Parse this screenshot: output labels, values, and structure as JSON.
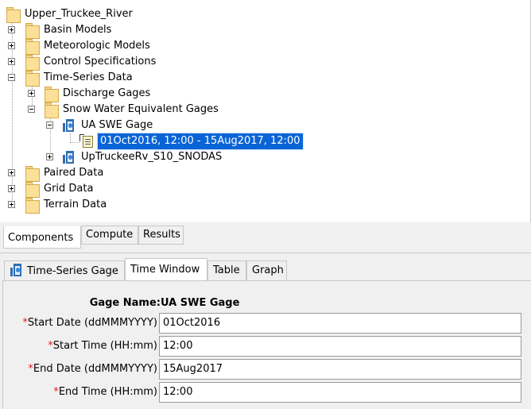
{
  "tree": {
    "root": "Upper_Truckee_River",
    "items": [
      {
        "label": "Basin Models"
      },
      {
        "label": "Meteorologic Models"
      },
      {
        "label": "Control Specifications"
      },
      {
        "label": "Time-Series Data"
      },
      {
        "label": "Discharge Gages"
      },
      {
        "label": "Snow Water Equivalent Gages"
      },
      {
        "label": "UA SWE Gage"
      },
      {
        "label": "01Oct2016, 12:00 - 15Aug2017, 12:00"
      },
      {
        "label": "UpTruckeeRv_S10_SNODAS"
      },
      {
        "label": "Paired Data"
      },
      {
        "label": "Grid Data"
      },
      {
        "label": "Terrain Data"
      }
    ]
  },
  "tree_tabs": [
    "Components",
    "Compute",
    "Results"
  ],
  "editor_tabs": [
    "Time-Series Gage",
    "Time Window",
    "Table",
    "Graph"
  ],
  "form": {
    "gage_name_label": "Gage Name:",
    "gage_name_value": "UA SWE Gage",
    "required_mark": "*",
    "start_date_label": "Start Date (ddMMMYYYY)",
    "start_date_value": "01Oct2016",
    "start_time_label": "Start Time (HH:mm)",
    "start_time_value": "12:00",
    "end_date_label": "End Date (ddMMMYYYY)",
    "end_date_value": "15Aug2017",
    "end_time_label": "End Time (HH:mm)",
    "end_time_value": "12:00"
  },
  "colors": {
    "selection": "#0a64d6",
    "required": "#e02020",
    "folder": "#fbe09a"
  }
}
